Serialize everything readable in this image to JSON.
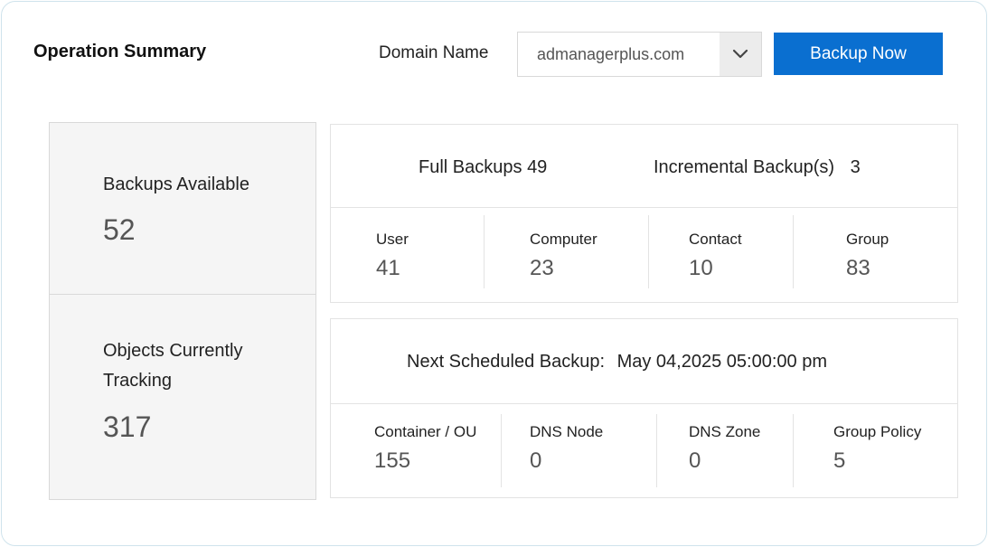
{
  "header": {
    "title": "Operation Summary",
    "domain_label": "Domain Name",
    "domain_value": "admanagerplus.com",
    "backup_button": "Backup Now"
  },
  "left": {
    "backups_available_label": "Backups Available",
    "backups_available_value": "52",
    "objects_tracking_label_line1": "Objects Currently",
    "objects_tracking_label_line2": "Tracking",
    "objects_tracking_value": "317"
  },
  "top_panel": {
    "full_backups_label": "Full Backups",
    "full_backups_value": "49",
    "incremental_label": "Incremental Backup(s)",
    "incremental_value": "3",
    "stats": [
      {
        "label": "User",
        "value": "41"
      },
      {
        "label": "Computer",
        "value": "23"
      },
      {
        "label": "Contact",
        "value": "10"
      },
      {
        "label": "Group",
        "value": "83"
      }
    ]
  },
  "bottom_panel": {
    "next_backup_label": "Next Scheduled Backup:",
    "next_backup_value": "May 04,2025 05:00:00 pm",
    "stats": [
      {
        "label": "Container / OU",
        "value": "155"
      },
      {
        "label": "DNS Node",
        "value": "0"
      },
      {
        "label": "DNS Zone",
        "value": "0"
      },
      {
        "label": "Group Policy",
        "value": "5"
      }
    ]
  },
  "colors": {
    "primary_button": "#0a6fd0",
    "card_background": "#f5f5f5",
    "border": "#d9d9d9"
  }
}
